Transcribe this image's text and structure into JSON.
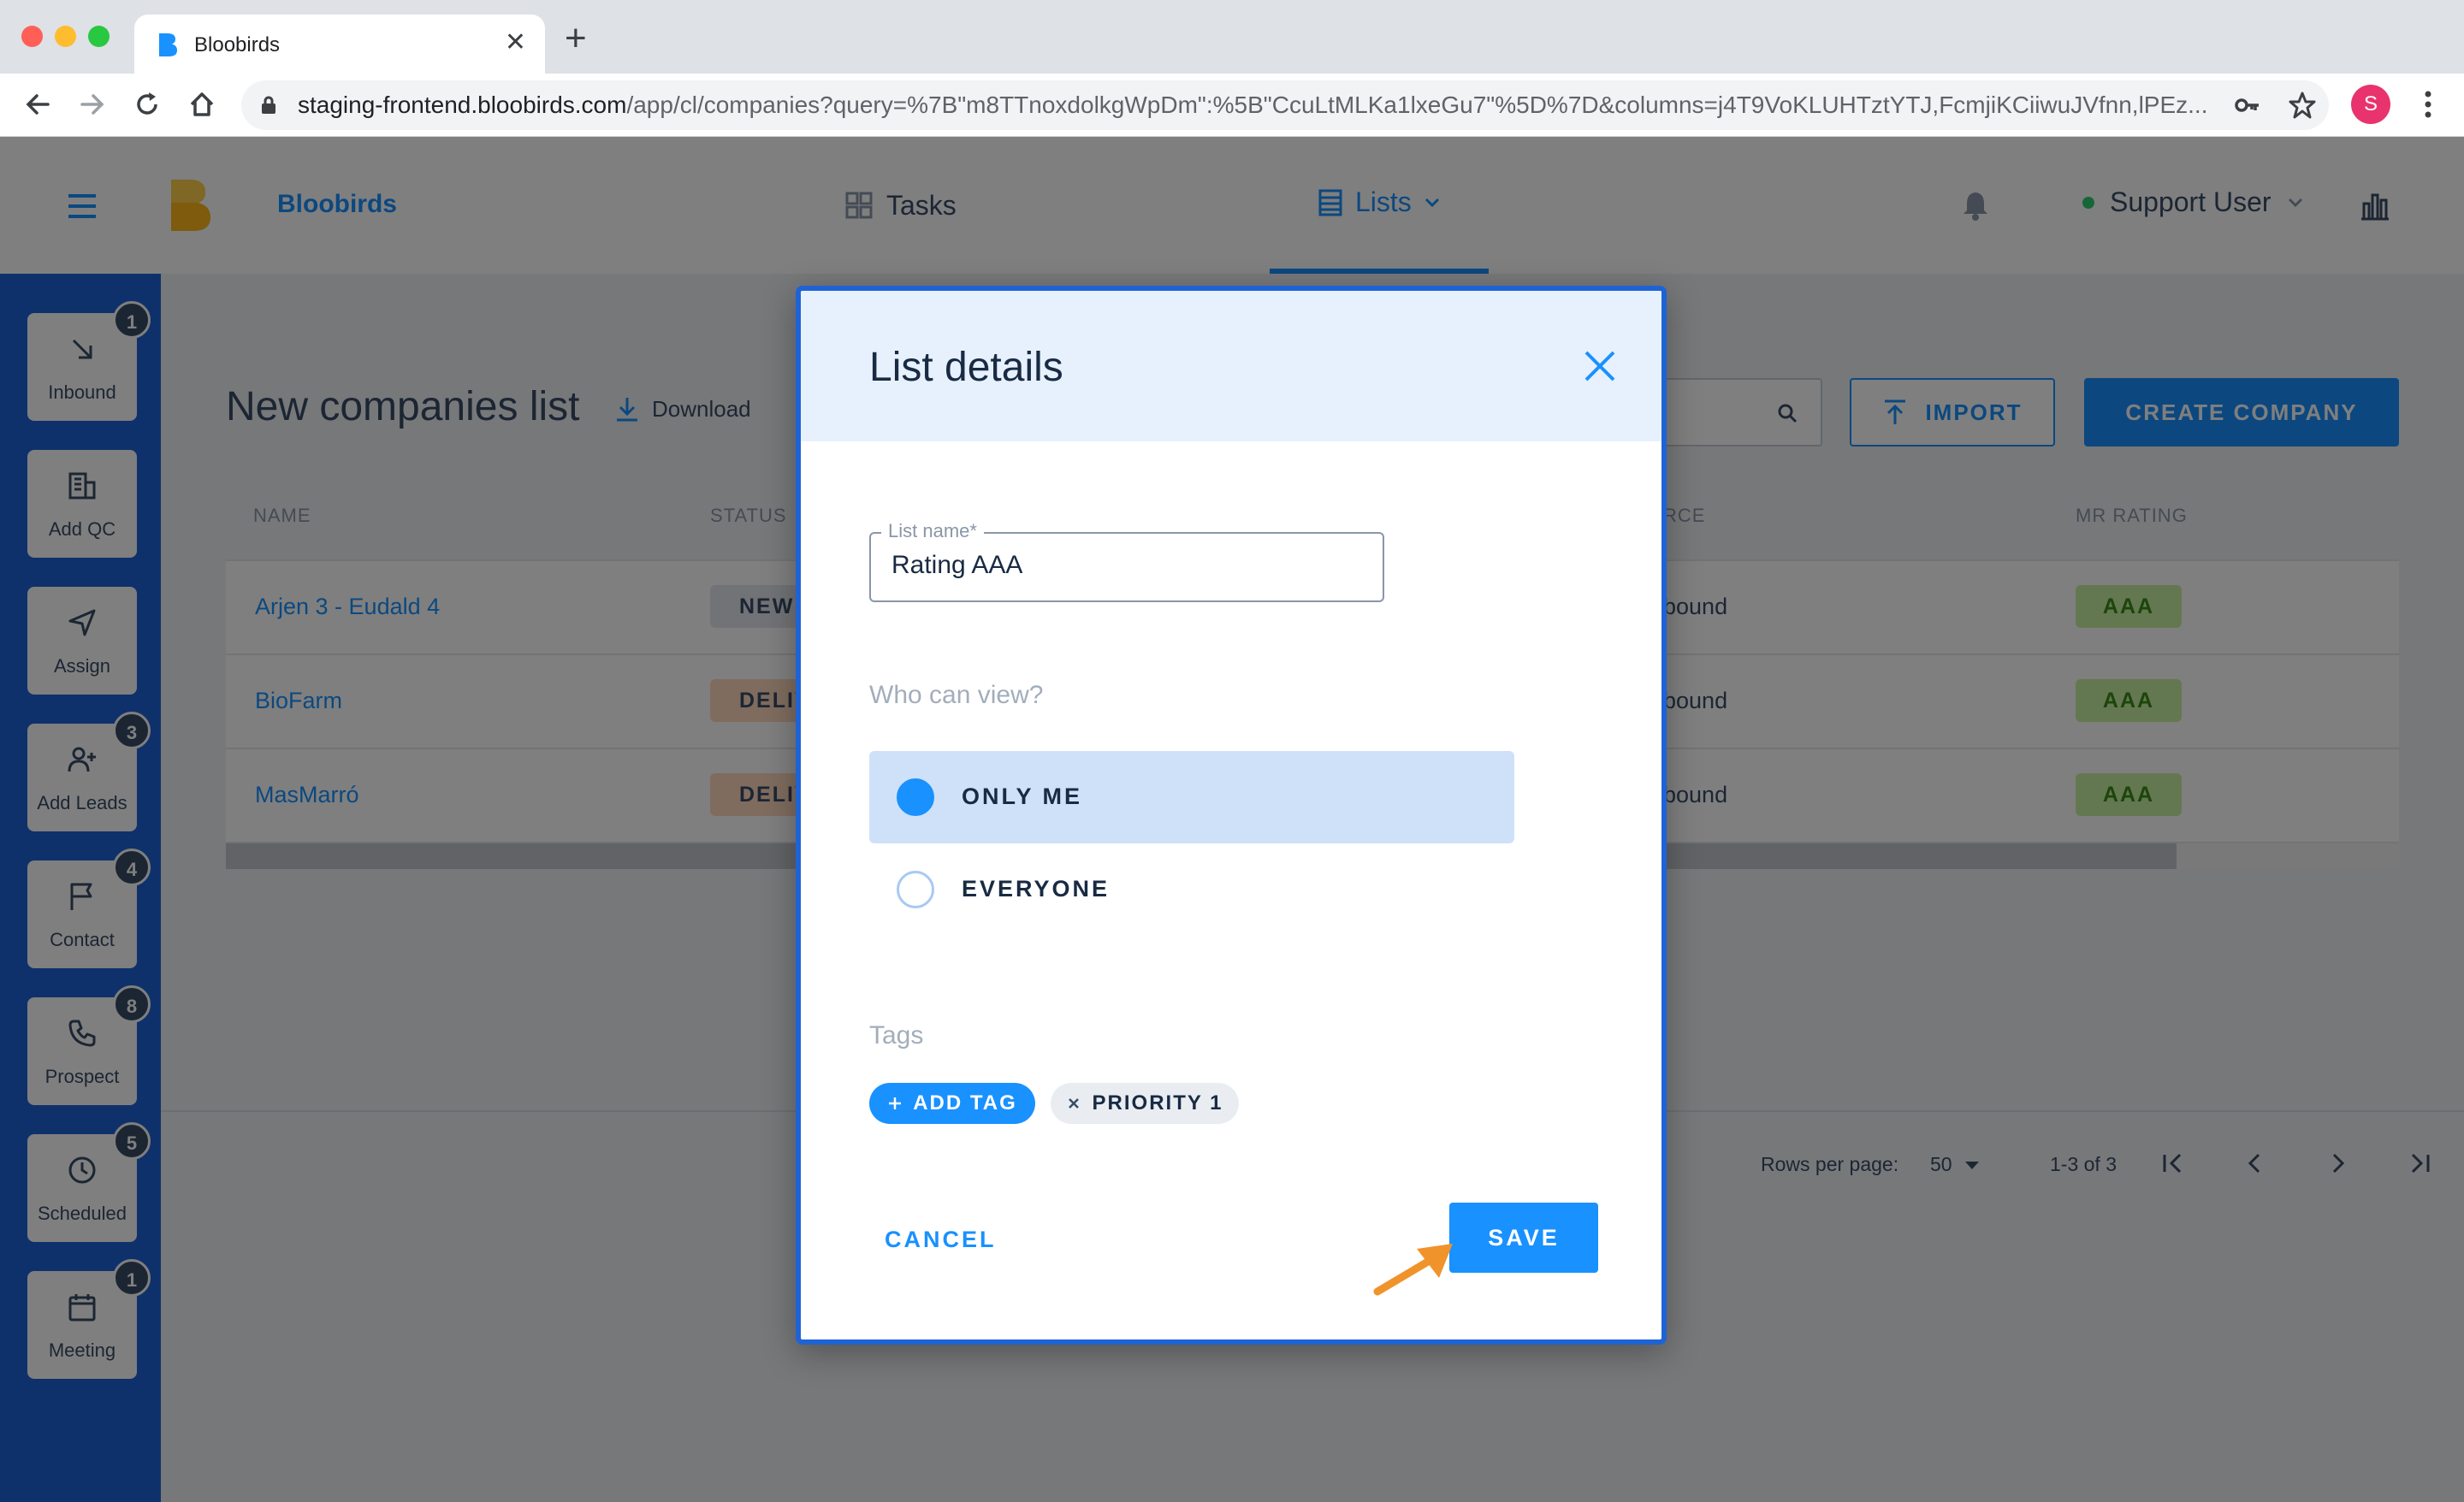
{
  "browser": {
    "tab_title": "Bloobirds",
    "new_tab_icon": "plus-icon",
    "url_host": "staging-frontend.bloobirds.com",
    "url_path": "/app/cl/companies?query=%7B\"m8TTnoxdolkgWpDm\":%5B\"CcuLtMLKa1lxeGu7\"%5D%7D&columns=j4T9VoKLUHTztYTJ,FcmjiKCiiwuJVfnn,lPEz...",
    "profile_initial": "S",
    "profile_color": "#e8336e"
  },
  "header": {
    "brand": "Bloobirds",
    "nav_tasks": "Tasks",
    "nav_lists": "Lists",
    "user_name": "Support User",
    "accent": "#1991ff"
  },
  "sidebar": {
    "items": [
      {
        "label": "Inbound",
        "badge": "1",
        "icon": "arrow-down-right-icon"
      },
      {
        "label": "Add QC",
        "badge": "",
        "icon": "building-icon"
      },
      {
        "label": "Assign",
        "badge": "",
        "icon": "send-icon"
      },
      {
        "label": "Add Leads",
        "badge": "3",
        "icon": "user-plus-icon"
      },
      {
        "label": "Contact",
        "badge": "4",
        "icon": "flag-icon"
      },
      {
        "label": "Prospect",
        "badge": "8",
        "icon": "phone-icon"
      },
      {
        "label": "Scheduled",
        "badge": "5",
        "icon": "clock-icon"
      },
      {
        "label": "Meeting",
        "badge": "1",
        "icon": "calendar-icon"
      }
    ]
  },
  "page": {
    "title": "New companies list",
    "download_label": "Download",
    "import_label": "IMPORT",
    "create_label": "CREATE COMPANY",
    "columns": {
      "name": "NAME",
      "status": "STATUS",
      "source": "RCE",
      "rating": "MR RATING"
    },
    "rows": [
      {
        "name": "Arjen 3 - Eudald 4",
        "status": "NEW",
        "status_color": "#e2e6ec",
        "source": "bound",
        "rating": "AAA"
      },
      {
        "name": "BioFarm",
        "status": "DELIV",
        "status_color": "#ffd9bf",
        "source": "bound",
        "rating": "AAA"
      },
      {
        "name": "MasMarró",
        "status": "DELIV",
        "status_color": "#ffd9bf",
        "source": "bound",
        "rating": "AAA"
      }
    ],
    "pagination": {
      "rows_per_page_label": "Rows per page:",
      "rows_per_page": "50",
      "range": "1-3 of 3"
    }
  },
  "modal": {
    "title": "List details",
    "list_name_label": "List name*",
    "list_name_value": "Rating AAA",
    "who_can_view_label": "Who can view?",
    "options": [
      {
        "label": "ONLY ME",
        "selected": true
      },
      {
        "label": "EVERYONE",
        "selected": false
      }
    ],
    "tags_label": "Tags",
    "add_tag_label": "ADD TAG",
    "tags": [
      "PRIORITY 1"
    ],
    "cancel_label": "CANCEL",
    "save_label": "SAVE",
    "annotation_color": "#f0932b"
  }
}
